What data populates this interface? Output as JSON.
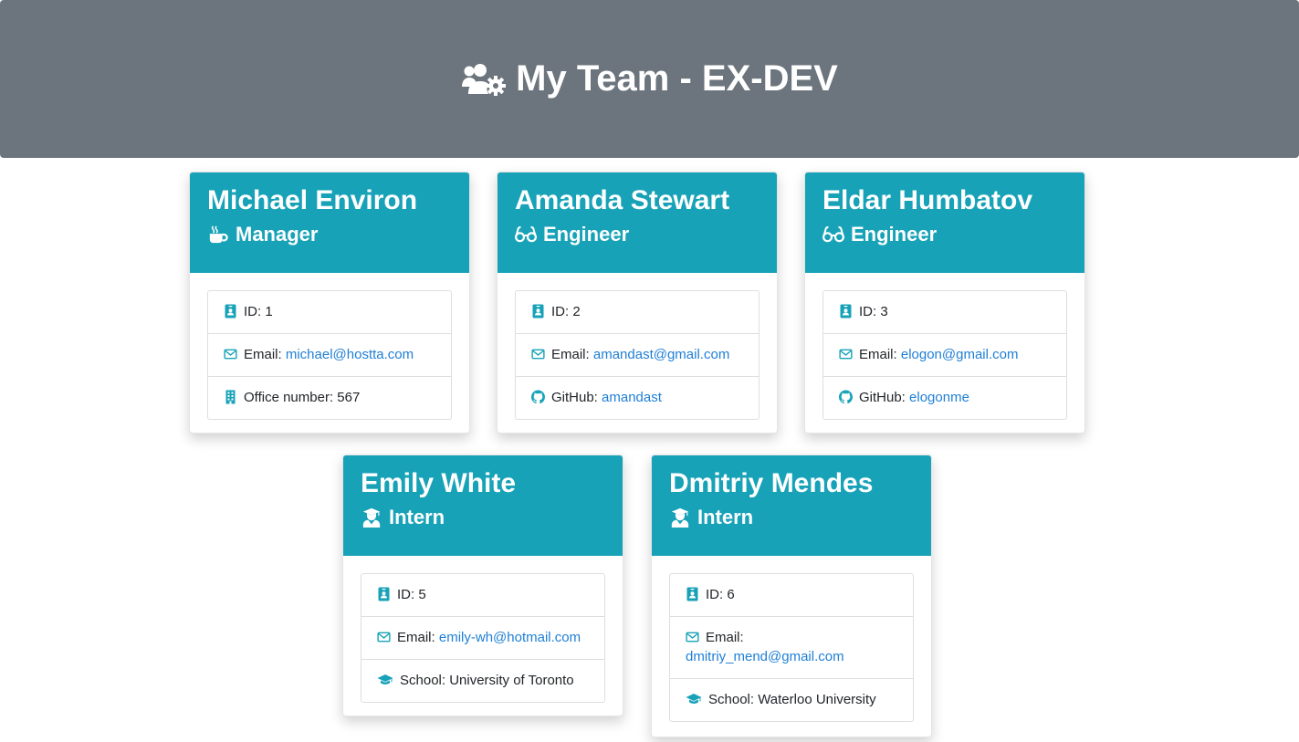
{
  "header": {
    "title": "My Team - EX-DEV",
    "icon": "users-cog-icon"
  },
  "colors": {
    "jumbotron": "#6c757d",
    "card_header": "#17a2b8",
    "link": "#1f7fd6",
    "icon_accent": "#17a2b8"
  },
  "cards": [
    {
      "name": "Michael Environ",
      "role": "Manager",
      "role_icon": "mug-hot-icon",
      "id_label": "ID: 1",
      "email_label": "Email:",
      "email": "michael@hostta.com",
      "extra_label": "Office number: 567",
      "extra_icon": "building-icon"
    },
    {
      "name": "Amanda Stewart",
      "role": "Engineer",
      "role_icon": "glasses-icon",
      "id_label": "ID: 2",
      "email_label": "Email:",
      "email": "amandast@gmail.com",
      "extra_label": "GitHub:",
      "extra_value": "amandast",
      "extra_icon": "github-icon"
    },
    {
      "name": "Eldar Humbatov",
      "role": "Engineer",
      "role_icon": "glasses-icon",
      "id_label": "ID: 3",
      "email_label": "Email:",
      "email": "elogon@gmail.com",
      "extra_label": "GitHub:",
      "extra_value": "elogonme",
      "extra_icon": "github-icon"
    },
    {
      "name": "Emily White",
      "role": "Intern",
      "role_icon": "user-graduate-icon",
      "id_label": "ID: 5",
      "email_label": "Email:",
      "email": "emily-wh@hotmail.com",
      "extra_label": "School: University of Toronto",
      "extra_icon": "graduation-cap-icon"
    },
    {
      "name": "Dmitriy Mendes",
      "role": "Intern",
      "role_icon": "user-graduate-icon",
      "id_label": "ID: 6",
      "email_label": "Email:",
      "email": "dmitriy_mend@gmail.com",
      "extra_label": "School: Waterloo University",
      "extra_icon": "graduation-cap-icon"
    }
  ]
}
